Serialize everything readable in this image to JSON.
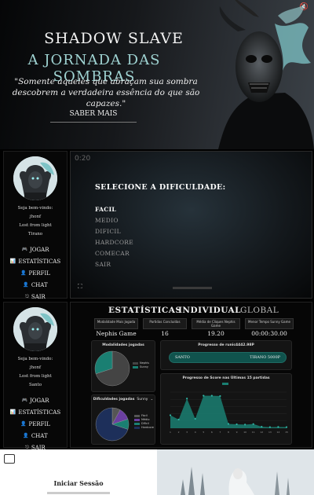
{
  "hero": {
    "title": "SHADOW SLAVE",
    "subtitle": "A JORNADA DAS SOMBRAS",
    "quote": "\"Somente aqueles que abraçam sua sombra descobrem a verdadeira essência do que são capazes.\"",
    "cta": "SABER MAIS",
    "mute_icon": "speaker-muted-icon"
  },
  "sidebar1": {
    "welcome": "Seja bem-vindo:",
    "user": "jhonf",
    "rank": "Lost from light",
    "title": "Tirano",
    "nav": [
      "JOGAR",
      "ESTATÍSTICAS",
      "PERFIL",
      "CHAT",
      "SAIR"
    ]
  },
  "sidebar2": {
    "welcome": "Seja bem-vindo:",
    "user": "jhonf",
    "rank": "Lost from light",
    "title": "Santo",
    "nav": [
      "JOGAR",
      "ESTATÍSTICAS",
      "PERFIL",
      "CHAT",
      "SAIR"
    ]
  },
  "game": {
    "timer": "0:20",
    "select_title": "SELECIONE A DIFICULDADE:",
    "options": [
      "FACIL",
      "MEDIO",
      "DIFICIL",
      "HARDCORE",
      "COMECAR",
      "SAIR"
    ],
    "selected": "FACIL"
  },
  "stats": {
    "tabs": [
      "ESTATÍSTICAS",
      "INDIVIDUAL",
      "GLOBAL"
    ],
    "headers": [
      "Modalidade Mais Jogada",
      "Partidas Concluídas",
      "Média de Cliques Nephis Game",
      "Menor Tempo Sunny Game"
    ],
    "values": [
      "Nephis Game",
      "16",
      "19.20",
      "00:00:30.00"
    ],
    "modalities_title": "Modalidades jogadas",
    "modalities_legend": [
      "Nephis",
      "Sunny"
    ],
    "difficulty_title": "Dificuldades jogadas",
    "difficulty_select": "Sunny",
    "difficulty_legend": [
      "Fácil",
      "Médio",
      "Difícil",
      "Hardcore"
    ],
    "progress_title": "Progresso de runic4442.98P",
    "progress_from": "SANTO",
    "progress_to": "TIRANO 5000P",
    "line_title": "Progresso de Score nas Últimas 15 partidas",
    "accent": "#1a7f72"
  },
  "chart_data": [
    {
      "type": "pie",
      "title": "Modalidades jogadas",
      "categories": [
        "Nephis",
        "Sunny"
      ],
      "values": [
        70,
        30
      ]
    },
    {
      "type": "pie",
      "title": "Dificuldades jogadas",
      "categories": [
        "Fácil",
        "Médio",
        "Difícil",
        "Hardcore"
      ],
      "values": [
        8,
        12,
        10,
        70
      ]
    },
    {
      "type": "area",
      "title": "Progresso de Score nas Últimas 15 partidas",
      "x": [
        1,
        2,
        3,
        4,
        5,
        6,
        7,
        8,
        9,
        10,
        11,
        12,
        13,
        14,
        15
      ],
      "series": [
        {
          "values": [
            180,
            120,
            410,
            130,
            450,
            450,
            445,
            60,
            55,
            50,
            58,
            20,
            15,
            18,
            15
          ]
        }
      ],
      "ylim": [
        0,
        500
      ]
    }
  ],
  "login": {
    "title": "Iniciar Sessão",
    "icon": "login-icon"
  }
}
